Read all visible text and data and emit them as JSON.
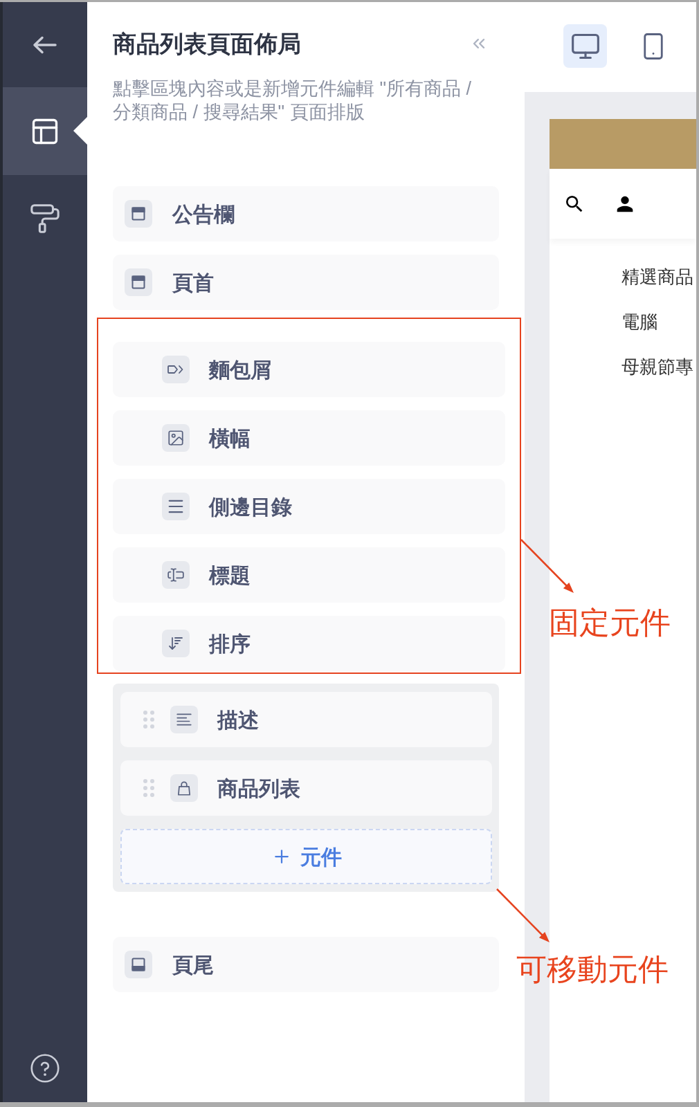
{
  "sidebar": {
    "nav": [
      {
        "kind": "layout",
        "selected": true
      },
      {
        "kind": "style",
        "selected": false
      }
    ]
  },
  "panel": {
    "title": "商品列表頁面佈局",
    "description": "點擊區塊內容或是新增元件編輯 \"所有商品 / 分類商品 / 搜尋結果\" 頁面排版",
    "top_blocks": [
      {
        "label": "公告欄"
      },
      {
        "label": "頁首"
      }
    ],
    "fixed_blocks": [
      {
        "kind": "breadcrumb",
        "label": "麵包屑"
      },
      {
        "kind": "banner",
        "label": "橫幅"
      },
      {
        "kind": "menu",
        "label": "側邊目錄"
      },
      {
        "kind": "title",
        "label": "標題"
      },
      {
        "kind": "sort",
        "label": "排序"
      }
    ],
    "movable_blocks": [
      {
        "kind": "text",
        "label": "描述"
      },
      {
        "kind": "products",
        "label": "商品列表"
      }
    ],
    "add_button": {
      "label": "元件"
    },
    "bottom_blocks": [
      {
        "label": "頁尾"
      }
    ]
  },
  "device_toggle": [
    {
      "kind": "desktop",
      "selected": true
    },
    {
      "kind": "mobile",
      "selected": false
    }
  ],
  "preview": {
    "menu": [
      "精選商品",
      "電腦",
      "母親節專"
    ]
  },
  "annotations": [
    {
      "text": "固定元件"
    },
    {
      "text": "可移動元件"
    }
  ]
}
